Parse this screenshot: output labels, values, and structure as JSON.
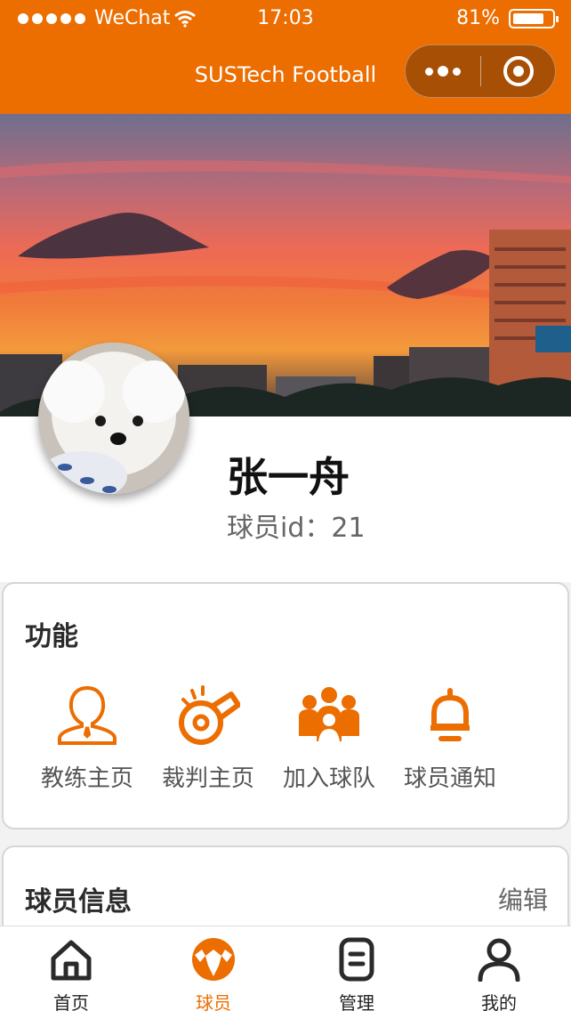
{
  "status_bar": {
    "carrier": "WeChat",
    "time": "17:03",
    "battery": "81%",
    "battery_level": 0.81
  },
  "nav": {
    "title": "SUSTech Football"
  },
  "profile": {
    "name": "张一舟",
    "player_id": "球员id：21"
  },
  "functions": {
    "title": "功能",
    "items": [
      {
        "label": "教练主页",
        "icon": "coach-icon"
      },
      {
        "label": "裁判主页",
        "icon": "whistle-icon"
      },
      {
        "label": "加入球队",
        "icon": "team-icon"
      },
      {
        "label": "球员通知",
        "icon": "bell-icon"
      }
    ]
  },
  "player_info": {
    "title": "球员信息",
    "edit_label": "编辑"
  },
  "tabbar": {
    "items": [
      {
        "label": "首页",
        "icon": "home-icon",
        "active": false
      },
      {
        "label": "球员",
        "icon": "football-icon",
        "active": true
      },
      {
        "label": "管理",
        "icon": "manage-icon",
        "active": false
      },
      {
        "label": "我的",
        "icon": "user-icon",
        "active": false
      }
    ]
  },
  "colors": {
    "accent": "#ec6d00",
    "text_dark": "#2b2b2b",
    "text_gray": "#666666"
  }
}
